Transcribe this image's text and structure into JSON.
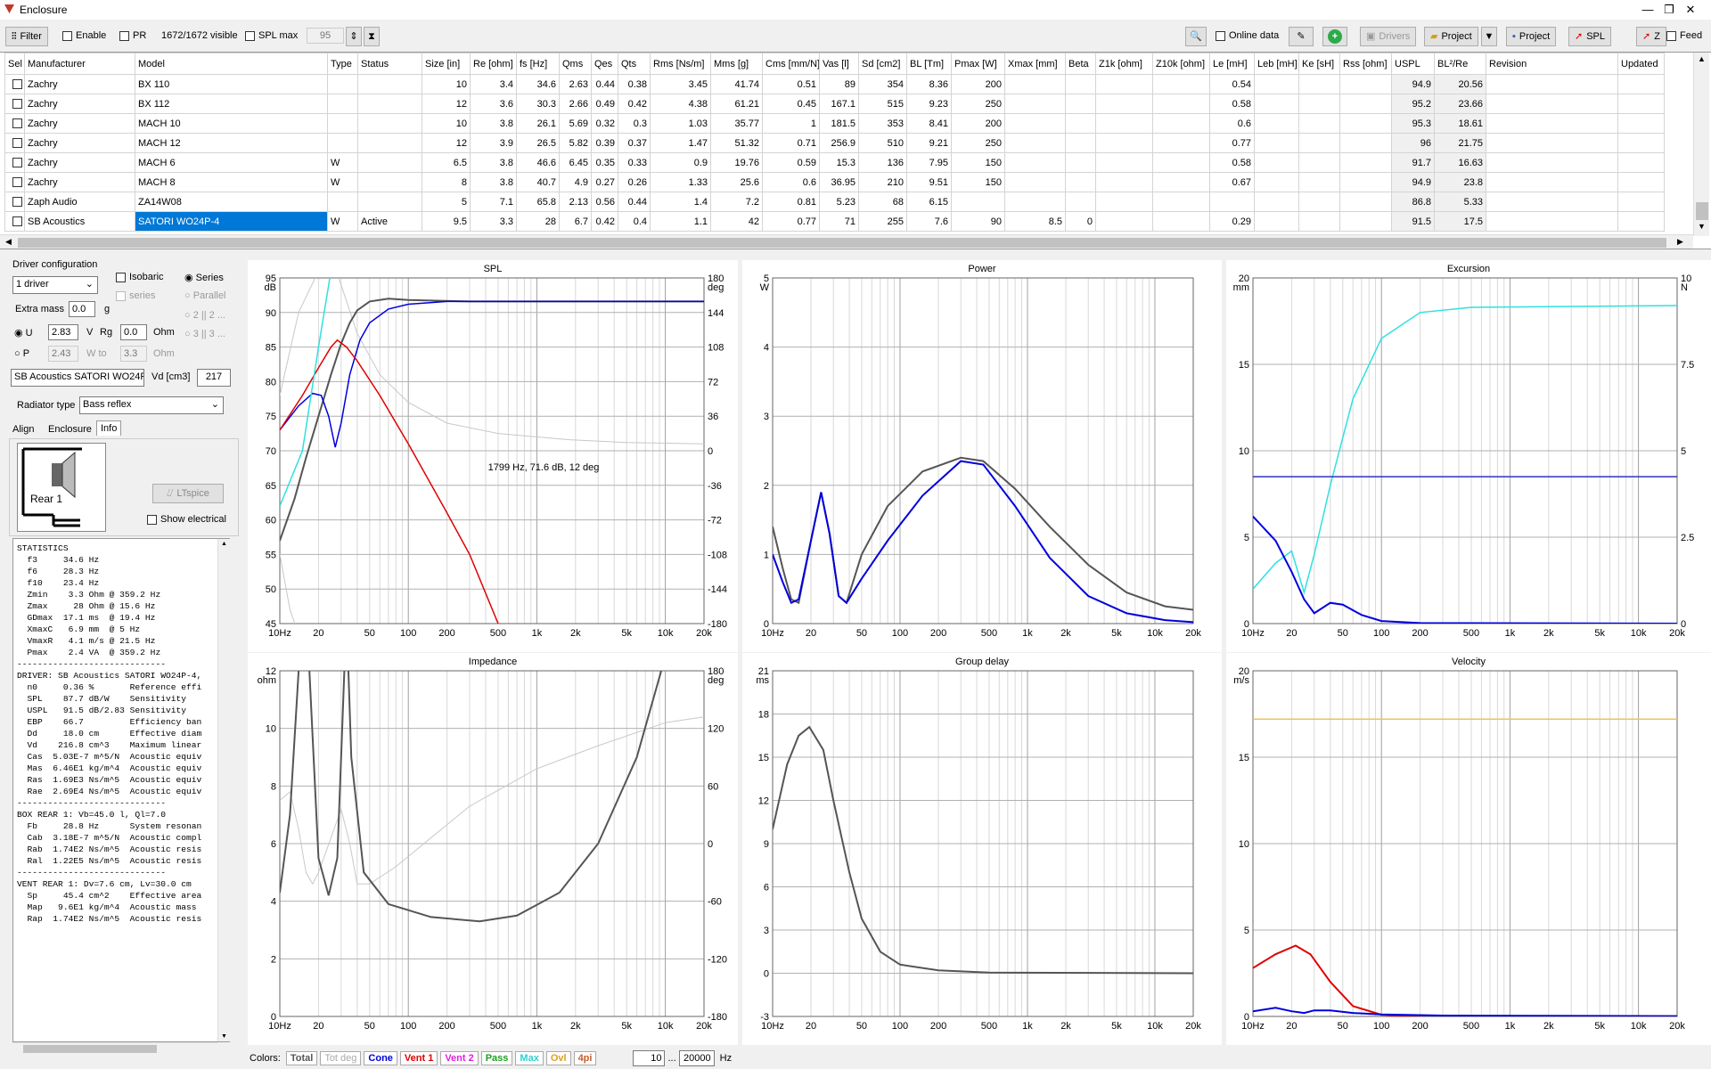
{
  "window": {
    "title": "Enclosure",
    "minimize": "—",
    "maximize": "❐",
    "close": "✕"
  },
  "toolbar": {
    "filter": "Filter",
    "enable": "Enable",
    "pr": "PR",
    "visible": "1672/1672 visible",
    "spl_max": "SPL max",
    "spl_max_value": "95",
    "online_data": "Online data",
    "drivers": "Drivers",
    "project1": "Project",
    "project2": "Project",
    "spl": "SPL",
    "z": "Z",
    "feed": "Feed"
  },
  "table": {
    "columns": [
      "Sel",
      "Manufacturer",
      "Model",
      "Type",
      "Status",
      "Size [in]",
      "Re [ohm]",
      "fs [Hz]",
      "Qms",
      "Qes",
      "Qts",
      "Rms [Ns/m]",
      "Mms [g]",
      "Cms [mm/N]",
      "Vas [l]",
      "Sd [cm2]",
      "BL [Tm]",
      "Pmax [W]",
      "Xmax [mm]",
      "Beta",
      "Z1k [ohm]",
      "Z10k [ohm]",
      "Le [mH]",
      "Leb [mH]",
      "Ke [sH]",
      "Rss [ohm]",
      "USPL",
      "BL²/Re",
      "Revision",
      "Updated"
    ],
    "rows": [
      [
        "",
        "Zachry",
        "BX 110",
        "",
        "",
        "10",
        "3.4",
        "34.6",
        "2.63",
        "0.44",
        "0.38",
        "3.45",
        "41.74",
        "0.51",
        "89",
        "354",
        "8.36",
        "200",
        "",
        "",
        "",
        "",
        "0.54",
        "",
        "",
        "",
        "94.9",
        "20.56",
        "",
        ""
      ],
      [
        "",
        "Zachry",
        "BX 112",
        "",
        "",
        "12",
        "3.6",
        "30.3",
        "2.66",
        "0.49",
        "0.42",
        "4.38",
        "61.21",
        "0.45",
        "167.1",
        "515",
        "9.23",
        "250",
        "",
        "",
        "",
        "",
        "0.58",
        "",
        "",
        "",
        "95.2",
        "23.66",
        "",
        ""
      ],
      [
        "",
        "Zachry",
        "MACH 10",
        "",
        "",
        "10",
        "3.8",
        "26.1",
        "5.69",
        "0.32",
        "0.3",
        "1.03",
        "35.77",
        "1",
        "181.5",
        "353",
        "8.41",
        "200",
        "",
        "",
        "",
        "",
        "0.6",
        "",
        "",
        "",
        "95.3",
        "18.61",
        "",
        ""
      ],
      [
        "",
        "Zachry",
        "MACH 12",
        "",
        "",
        "12",
        "3.9",
        "26.5",
        "5.82",
        "0.39",
        "0.37",
        "1.47",
        "51.32",
        "0.71",
        "256.9",
        "510",
        "9.21",
        "250",
        "",
        "",
        "",
        "",
        "0.77",
        "",
        "",
        "",
        "96",
        "21.75",
        "",
        ""
      ],
      [
        "",
        "Zachry",
        "MACH 6",
        "W",
        "",
        "6.5",
        "3.8",
        "46.6",
        "6.45",
        "0.35",
        "0.33",
        "0.9",
        "19.76",
        "0.59",
        "15.3",
        "136",
        "7.95",
        "150",
        "",
        "",
        "",
        "",
        "0.58",
        "",
        "",
        "",
        "91.7",
        "16.63",
        "",
        ""
      ],
      [
        "",
        "Zachry",
        "MACH 8",
        "W",
        "",
        "8",
        "3.8",
        "40.7",
        "4.9",
        "0.27",
        "0.26",
        "1.33",
        "25.6",
        "0.6",
        "36.95",
        "210",
        "9.51",
        "150",
        "",
        "",
        "",
        "",
        "0.67",
        "",
        "",
        "",
        "94.9",
        "23.8",
        "",
        ""
      ],
      [
        "",
        "Zaph Audio",
        "ZA14W08",
        "",
        "",
        "5",
        "7.1",
        "65.8",
        "2.13",
        "0.56",
        "0.44",
        "1.4",
        "7.2",
        "0.81",
        "5.23",
        "68",
        "6.15",
        "",
        "",
        "",
        "",
        "",
        "",
        "",
        "",
        "",
        "86.8",
        "5.33",
        "",
        ""
      ],
      [
        "",
        "SB Acoustics",
        "SATORI WO24P-4",
        "W",
        "Active",
        "9.5",
        "3.3",
        "28",
        "6.7",
        "0.42",
        "0.4",
        "1.1",
        "42",
        "0.77",
        "71",
        "255",
        "7.6",
        "90",
        "8.5",
        "0",
        "",
        "",
        "0.29",
        "",
        "",
        "",
        "91.5",
        "17.5",
        "",
        ""
      ]
    ]
  },
  "left": {
    "driver_configuration": "Driver configuration",
    "drivers_select": "1 driver",
    "isobaric": "Isobaric",
    "series": "Series",
    "series2": "series",
    "parallel": "Parallel",
    "two_two": "2 || 2 ...",
    "three_three": "3 || 3 ...",
    "extra_mass": "Extra mass",
    "extra_mass_value": "0.0",
    "g": "g",
    "u": "U",
    "u_value": "2.83",
    "v": "V",
    "rg": "Rg",
    "rg_value": "0.0",
    "ohm": "Ohm",
    "p": "P",
    "p_value": "2.43",
    "w_to": "W to",
    "w_to_value": "3.3",
    "ohm2": "Ohm",
    "driver_name": "SB Acoustics SATORI WO24P",
    "vd_label": "Vd [cm3]",
    "vd_value": "217",
    "radiator_type": "Radiator type",
    "radiator_value": "Bass reflex",
    "tab_align": "Align",
    "tab_enclosure": "Enclosure",
    "tab_info": "Info",
    "rear_label": "Rear 1",
    "ltspice": "LTspice",
    "show_electrical": "Show electrical"
  },
  "statistics": "STATISTICS\n  f3     34.6 Hz\n  f6     28.3 Hz\n  f10    23.4 Hz\n  Zmin    3.3 Ohm @ 359.2 Hz\n  Zmax     28 Ohm @ 15.6 Hz\n  GDmax  17.1 ms  @ 19.4 Hz\n  XmaxC   6.9 mm  @ 5 Hz\n  VmaxR   4.1 m/s @ 21.5 Hz\n  Pmax    2.4 VA  @ 359.2 Hz\n-----------------------------\nDRIVER: SB Acoustics SATORI WO24P-4,\n  n0     0.36 %       Reference effi\n  SPL    87.7 dB/W    Sensitivity\n  USPL   91.5 dB/2.83 Sensitivity\n  EBP    66.7         Efficiency ban\n  Dd     18.0 cm      Effective diam\n  Vd    216.8 cm^3    Maximum linear\n  Cas  5.03E-7 m^5/N  Acoustic equiv\n  Mas  6.46E1 kg/m^4  Acoustic equiv\n  Ras  1.69E3 Ns/m^5  Acoustic equiv\n  Rae  2.69E4 Ns/m^5  Acoustic equiv\n-----------------------------\nBOX REAR 1: Vb=45.0 l, Ql=7.0\n  Fb     28.8 Hz      System resonan\n  Cab  3.18E-7 m^5/N  Acoustic compl\n  Rab  1.74E2 Ns/m^5  Acoustic resis\n  Ral  1.22E5 Ns/m^5  Acoustic resis\n-----------------------------\nVENT REAR 1: Dv=7.6 cm, Lv=30.0 cm\n  Sp     45.4 cm^2    Effective area\n  Map   9.6E1 kg/m^4  Acoustic mass\n  Rap  1.74E2 Ns/m^5  Acoustic resis",
  "plots": {
    "spl": {
      "title": "SPL",
      "yunit": "dB",
      "yunit2": "deg",
      "yticks": [
        "95",
        "90",
        "85",
        "80",
        "75",
        "70",
        "65",
        "60",
        "55",
        "50",
        "45"
      ],
      "y2ticks": [
        "180",
        "144",
        "108",
        "72",
        "36",
        "0",
        "-36",
        "-72",
        "-108",
        "-144",
        "-180"
      ],
      "annotation": "1799 Hz, 71.6 dB, 12 deg"
    },
    "power": {
      "title": "Power",
      "yunit": "W",
      "yticks": [
        "5",
        "4",
        "3",
        "2",
        "1",
        "0"
      ]
    },
    "excursion": {
      "title": "Excursion",
      "yunit": "mm",
      "yunit2": "N",
      "yticks": [
        "20",
        "15",
        "10",
        "5",
        "0"
      ],
      "y2ticks": [
        "10",
        "7.5",
        "5",
        "2.5",
        "0"
      ]
    },
    "impedance": {
      "title": "Impedance",
      "yunit": "ohm",
      "yunit2": "deg",
      "yticks": [
        "12",
        "10",
        "8",
        "6",
        "4",
        "2",
        "0"
      ],
      "y2ticks": [
        "180",
        "120",
        "60",
        "0",
        "-60",
        "-120",
        "-180"
      ]
    },
    "group_delay": {
      "title": "Group delay",
      "yunit": "ms",
      "yticks": [
        "21",
        "18",
        "15",
        "12",
        "9",
        "6",
        "3",
        "0",
        "-3"
      ]
    },
    "velocity": {
      "title": "Velocity",
      "yunit": "m/s",
      "yticks": [
        "20",
        "15",
        "10",
        "5",
        "0"
      ]
    },
    "xticks": [
      "10Hz",
      "20",
      "50",
      "100",
      "200",
      "500",
      "1k",
      "2k",
      "5k",
      "10k",
      "20k"
    ]
  },
  "bottom": {
    "colors_label": "Colors:",
    "total": "Total",
    "tot_deg": "Tot deg",
    "cone": "Cone",
    "vent1": "Vent 1",
    "vent2": "Vent 2",
    "pass": "Pass",
    "max": "Max",
    "ovl": "Ovl",
    "fourpi": "4pi",
    "fmin": "10",
    "dots": "...",
    "fmax": "20000",
    "hz": "Hz"
  },
  "colors": {
    "selection": "#0078d7",
    "total": "#555555",
    "cone": "#0000dd",
    "vent": "#e00000",
    "cyan": "#30e0e0",
    "orange": "#f0c060"
  }
}
